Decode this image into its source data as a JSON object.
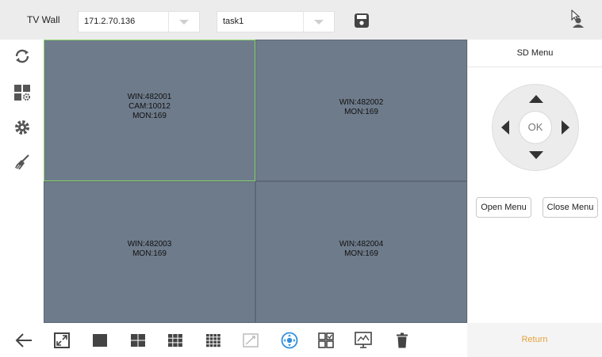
{
  "header": {
    "title": "TV Wall",
    "device_select": "171.2.70.136",
    "task_select": "task1",
    "save_icon": "save-icon",
    "user_icon": "user-icon"
  },
  "sidebar": {
    "items": [
      {
        "icon": "refresh-icon"
      },
      {
        "icon": "layout-settings-icon"
      },
      {
        "icon": "gear-icon"
      },
      {
        "icon": "clean-brush-icon"
      }
    ]
  },
  "windows": [
    {
      "win": "WIN:482001",
      "cam": "CAM:10012",
      "mon": "MON:169",
      "selected": true
    },
    {
      "win": "WIN:482002",
      "mon": "MON:169"
    },
    {
      "win": "WIN:482003",
      "mon": "MON:169"
    },
    {
      "win": "WIN:482004",
      "mon": "MON:169"
    }
  ],
  "panel": {
    "title": "SD Menu",
    "ok_label": "OK",
    "open_menu": "Open Menu",
    "close_menu": "Close Menu",
    "return_label": "Return"
  },
  "toolbar": {
    "back_icon": "back-arrow-icon",
    "icons": [
      "fullscreen-icon",
      "layout-1-icon",
      "layout-4-icon",
      "layout-9-icon",
      "layout-16-icon",
      "custom-layout-icon",
      "ptz-control-icon",
      "split-window-icon",
      "monitor-icon",
      "delete-icon"
    ]
  },
  "colors": {
    "grid_bg": "#6e7b8b",
    "selected_border": "#8bd66a",
    "return_text": "#e6a23c",
    "active_icon": "#2f8fdd"
  }
}
